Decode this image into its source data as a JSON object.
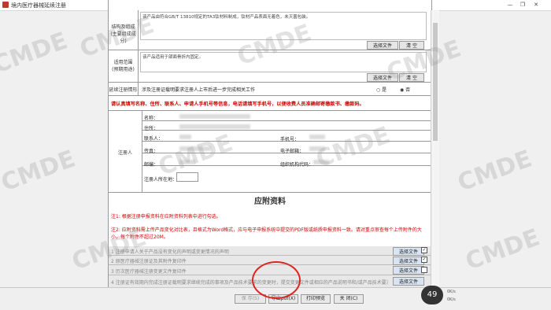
{
  "window": {
    "title": "境内医疗器械延续注册",
    "minimize": "—",
    "restore": "❐",
    "close": "✕"
  },
  "composition": {
    "label": "结构及组成\n(主要组成成分)",
    "text": "该产品由符合GB/T 13810规定的TA3钛材料制成，钛材产品表面无着色，未灭菌包装。",
    "select_button": "选择文件",
    "clear_button": "清 空"
  },
  "scope": {
    "label": "适用范围\n(预期用途)",
    "text": "该产品适用于颌面骨折内固定。",
    "select_button": "选择文件",
    "clear_button": "清 空"
  },
  "change": {
    "label": "延续注册情形",
    "text": "涉及注册证载明要求注册人上市后进一步完成相关工作",
    "yes": "是",
    "no": "否"
  },
  "notice": "请认真填写名称、住所、联系人、申请人手机号等信息，电话请填写手机号，以便收费人员准确邮寄缴款书、缴款码。",
  "registrant": {
    "label": "注册人",
    "name": "名称：",
    "address": "住所：",
    "contact": "联系人：",
    "mobile": "手机号：",
    "fax": "传真：",
    "email_cn": "电子邮箱：",
    "post": "邮编：",
    "org_code": "组织机构代码：",
    "region": "注册人所在地："
  },
  "attachments": {
    "heading": "应附资料",
    "note1": "注1: 根据注册申报资料在应附资料列表中进行勾选。",
    "note2": "注2: 应附资料需上传产品变化对比表，且格式为Word格式，应与电子申报系统中提交的PDF版或纸质申报资料一致。请对重点审查每个上传附件的大小，每个附件不超过20M。",
    "items": [
      {
        "text": "1 注册申请人关于产品没有变化的声明或变更情况的声明",
        "button": "选择文件",
        "checked": true
      },
      {
        "text": "2 原医疗器械注册证及其附件复印件",
        "button": "选择文件",
        "checked": true
      },
      {
        "text": "3 历次医疗器械注册变更文件复印件",
        "button": "选择文件",
        "checked": false
      },
      {
        "text": "4 注册证有效期内完成注册证载明要求继续完成的事项及产品技术要求的变更时，提交变更文件或相应的产品说明书和/或产品技术要求等一式两份",
        "button": "选择文件",
        "checked": false
      }
    ]
  },
  "footer": {
    "save": "保 存(S)",
    "export": "导出pdf(X)",
    "print": "打印预览",
    "close": "关 闭(C)"
  },
  "overlay": {
    "timer": "49",
    "up_speed": "0K/s",
    "down_speed": "0K/s"
  },
  "watermark": "CMDE"
}
